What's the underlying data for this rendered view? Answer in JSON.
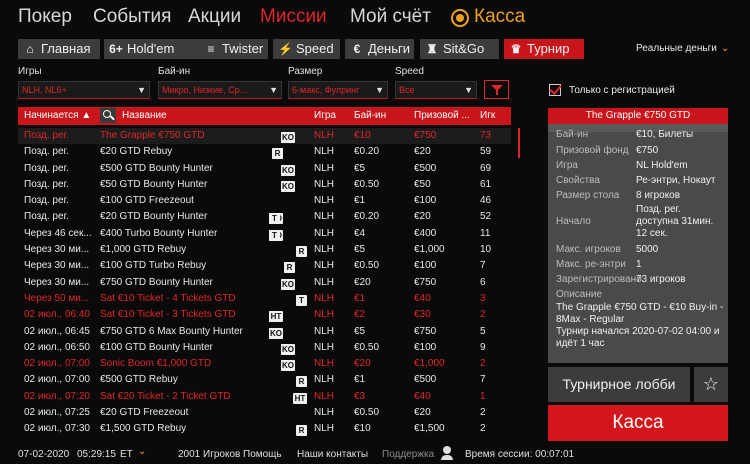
{
  "topnav": [
    "Покер",
    "События",
    "Акции",
    "Миссии",
    "Мой счёт",
    "Касса"
  ],
  "tabs": [
    {
      "label": "Главная",
      "icon": "home-icon",
      "glyph": "⌂"
    },
    {
      "label": "Hold'em",
      "icon": "six-plus-icon",
      "glyph": "6+"
    },
    {
      "label": "Twister",
      "icon": "twister-icon",
      "glyph": "≡"
    },
    {
      "label": "Speed",
      "icon": "lightning-icon",
      "glyph": "⚡"
    },
    {
      "label": "Деньги",
      "icon": "euro-icon",
      "glyph": "€"
    },
    {
      "label": "Sit&Go",
      "icon": "trophy-icon",
      "glyph": "♜"
    },
    {
      "label": "Турнир",
      "icon": "cup-icon",
      "glyph": "♛"
    }
  ],
  "real_money": "Реальные деньги",
  "filters": [
    {
      "label": "Игры",
      "value": "NLH, NL6+"
    },
    {
      "label": "Бай-ин",
      "value": "Микро, Низкие, Ср..."
    },
    {
      "label": "Размер",
      "value": "6-макс, Фулринг"
    },
    {
      "label": "Speed",
      "value": "Все"
    }
  ],
  "columns": {
    "start": "Начинается ▲",
    "name": "Название",
    "game": "Игра",
    "buyin": "Бай-ин",
    "prize": "Призовой ...",
    "players": "Игк"
  },
  "rows": [
    {
      "start": "Позд. рег.",
      "name": "The Grapple €750 GTD",
      "badges": [
        "↶",
        "KO"
      ],
      "game": "NLH",
      "buyin": "€10",
      "prize": "€750",
      "players": "73",
      "red": true,
      "hl": true
    },
    {
      "start": "Позд. рег.",
      "name": "€20 GTD Rebuy",
      "badges": [
        "6",
        "T",
        "R"
      ],
      "game": "NLH",
      "buyin": "€0.20",
      "prize": "€20",
      "players": "59"
    },
    {
      "start": "Позд. рег.",
      "name": "€500 GTD Bounty Hunter",
      "badges": [
        "↶",
        "KO"
      ],
      "game": "NLH",
      "buyin": "€5",
      "prize": "€500",
      "players": "69"
    },
    {
      "start": "Позд. рег.",
      "name": "€50 GTD Bounty Hunter",
      "badges": [
        "↶",
        "KO"
      ],
      "game": "NLH",
      "buyin": "€0.50",
      "prize": "€50",
      "players": "61"
    },
    {
      "start": "Позд. рег.",
      "name": "€100 GTD Freezeout",
      "badges": [],
      "game": "NLH",
      "buyin": "€1",
      "prize": "€100",
      "players": "46"
    },
    {
      "start": "Позд. рег.",
      "name": "€20 GTD Bounty Hunter",
      "badges": [
        "↶",
        "KO",
        "T"
      ],
      "game": "NLH",
      "buyin": "€0.20",
      "prize": "€20",
      "players": "52"
    },
    {
      "start": "Через 46 сек...",
      "name": "€400 Turbo Bounty Hunter",
      "badges": [
        "↶",
        "KO",
        "T"
      ],
      "game": "NLH",
      "buyin": "€4",
      "prize": "€400",
      "players": "11"
    },
    {
      "start": "Через 30 ми...",
      "name": "€1,000 GTD Rebuy",
      "badges": [
        "R"
      ],
      "game": "NLH",
      "buyin": "€5",
      "prize": "€1,000",
      "players": "10"
    },
    {
      "start": "Через 30 ми...",
      "name": "€100 GTD Turbo Rebuy",
      "badges": [
        "T",
        "R"
      ],
      "game": "NLH",
      "buyin": "€0.50",
      "prize": "€100",
      "players": "7"
    },
    {
      "start": "Через 30 ми...",
      "name": "€750 GTD Bounty Hunter",
      "badges": [
        "↶",
        "KO"
      ],
      "game": "NLH",
      "buyin": "€20",
      "prize": "€750",
      "players": "6"
    },
    {
      "start": "Через 50 ми...",
      "name": "Sat €10 Ticket - 4 Tickets GTD",
      "badges": [
        "T"
      ],
      "game": "NLH",
      "buyin": "€1",
      "prize": "€40",
      "players": "3",
      "red": true
    },
    {
      "start": "02 июл., 06:40",
      "name": "Sat €10 Ticket - 3 Tickets GTD",
      "badges": [
        "↶",
        "6",
        "HT"
      ],
      "game": "NLH",
      "buyin": "€2",
      "prize": "€30",
      "players": "2",
      "red": true
    },
    {
      "start": "02 июл., 06:45",
      "name": "€750 GTD 6 Max Bounty Hunter",
      "badges": [
        "↶",
        "6",
        "KO"
      ],
      "game": "NLH",
      "buyin": "€5",
      "prize": "€750",
      "players": "5"
    },
    {
      "start": "02 июл., 06:50",
      "name": "€100 GTD Bounty Hunter",
      "badges": [
        "↶",
        "KO"
      ],
      "game": "NLH",
      "buyin": "€0.50",
      "prize": "€100",
      "players": "9"
    },
    {
      "start": "02 июл., 07:00",
      "name": "Sonic Boom €1,000 GTD",
      "badges": [
        "↶",
        "KO"
      ],
      "game": "NLH",
      "buyin": "€20",
      "prize": "€1,000",
      "players": "2",
      "red": true
    },
    {
      "start": "02 июл., 07:00",
      "name": "€500 GTD Rebuy",
      "badges": [
        "R"
      ],
      "game": "NLH",
      "buyin": "€1",
      "prize": "€500",
      "players": "7"
    },
    {
      "start": "02 июл., 07:20",
      "name": "Sat €20 Ticket - 2 Ticket GTD",
      "badges": [
        "HT"
      ],
      "game": "NLH",
      "buyin": "€3",
      "prize": "€40",
      "players": "1",
      "red": true
    },
    {
      "start": "02 июл., 07:25",
      "name": "€20 GTD Freezeout",
      "badges": [],
      "game": "NLH",
      "buyin": "€0.50",
      "prize": "€20",
      "players": "2"
    },
    {
      "start": "02 июл., 07:30",
      "name": "€1,500 GTD Rebuy",
      "badges": [
        "R"
      ],
      "game": "NLH",
      "buyin": "€10",
      "prize": "€1,500",
      "players": "2"
    }
  ],
  "reg_only": "Только с регистрацией",
  "details": {
    "title": "The Grapple €750 GTD",
    "fields": [
      {
        "k": "Бай-ин",
        "v": "€10, Билеты"
      },
      {
        "k": "Призовой фонд",
        "v": "€750"
      },
      {
        "k": "Игра",
        "v": "NL Hold'em"
      },
      {
        "k": "Свойства",
        "v": "Ре-энтри, Нокаут"
      },
      {
        "k": "Размер стола",
        "v": "8 игроков"
      }
    ],
    "start_label": "Начало",
    "start_lines": [
      "Позд. рег.",
      "доступна 31мин.",
      "12 сек."
    ],
    "fields2": [
      {
        "k": "Макс. игроков",
        "v": "5000"
      },
      {
        "k": "Макс. ре-энтри",
        "v": "1"
      },
      {
        "k": "Зарегистрировано",
        "v": "73 игроков"
      }
    ],
    "desc_label": "Описание",
    "desc_text": "The Grapple €750 GTD - €10 Buy-in - 8Max - Regular",
    "desc_text2": "Турнир начался 2020-07-02 04:00 и идёт 1 час"
  },
  "lobby_btn": "Турнирное лобби",
  "kassa_btn": "Касса",
  "status": {
    "date": "07-02-2020",
    "time": "05:29:15",
    "tz": "ET",
    "players": "2001 Игроков",
    "help": "Помощь",
    "contacts": "Наши контакты",
    "support": "Поддержка",
    "session": "Время сессии: 00:07:01"
  },
  "colors": {
    "accent": "#c8151b",
    "gold": "#f0a020",
    "bg": "#0a0a0a"
  }
}
